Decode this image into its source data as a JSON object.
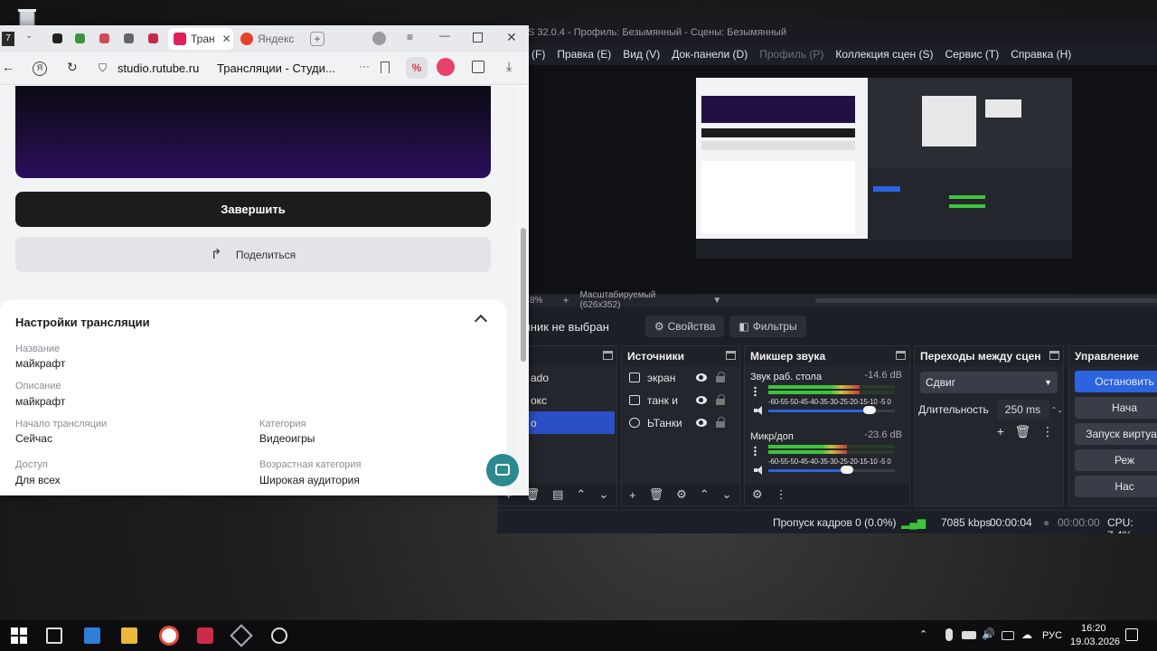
{
  "obs": {
    "title": "S 32.0.4 - Профиль: Безымянный - Сцены: Безымянный",
    "menu": [
      {
        "label": "(F)",
        "dim": false
      },
      {
        "label": "Правка (E)",
        "dim": false
      },
      {
        "label": "Вид (V)",
        "dim": false
      },
      {
        "label": "Док-панели (D)",
        "dim": false
      },
      {
        "label": "Профиль (P)",
        "dim": true
      },
      {
        "label": "Коллекция сцен (S)",
        "dim": false
      },
      {
        "label": "Сервис (T)",
        "dim": false
      },
      {
        "label": "Справка (H)",
        "dim": false
      }
    ],
    "zoom_percent": "8%",
    "zoom_mode": "Масштабируемый (626x352)",
    "no_source": "чник не выбран",
    "properties_btn": "Свойства",
    "filters_btn": "Фильтры",
    "scenes_dock": {
      "title": "ы",
      "items": [
        "ado",
        "окс",
        "о"
      ]
    },
    "sources_dock": {
      "title": "Источники",
      "items": [
        "экран",
        "танк и",
        "ЬТанки"
      ]
    },
    "mixer": {
      "title": "Микшер звука",
      "channels": [
        {
          "name": "Звук раб. стола",
          "db": "-14.6 dB",
          "level": 0.72,
          "volume": 0.8
        },
        {
          "name": "Микр/доп",
          "db": "-23.6 dB",
          "level": 0.62,
          "volume": 0.62
        }
      ],
      "scale": "-60-55-50-45-40-35-30-25-20-15-10 -5  0"
    },
    "transitions": {
      "title": "Переходы между сцен",
      "selected": "Сдвиг",
      "duration_label": "Длительность",
      "duration_value": "250 ms"
    },
    "controls": {
      "title": "Управление",
      "buttons": [
        "Остановить",
        "Нача",
        "Запуск виртуал",
        "Реж",
        "Нас"
      ]
    },
    "status": {
      "dropped": "Пропуск кадров 0 (0.0%)",
      "bitrate": "7085 kbps",
      "stream_time": "00:00:04",
      "record_time": "00:00:00",
      "cpu": "CPU: 7.4%"
    }
  },
  "browser": {
    "tab_count": "7",
    "tabs": [
      {
        "label": "Тран",
        "active": true
      },
      {
        "label": "Яндекс",
        "active": false
      }
    ],
    "url": "studio.rutube.ru",
    "page_title": "Трансляции - Студи...",
    "finish_btn": "Завершить",
    "share_btn": "Поделиться",
    "settings": {
      "title": "Настройки трансляции",
      "fields": {
        "name_label": "Название",
        "name_value": "майкрафт",
        "desc_label": "Описание",
        "desc_value": "майкрафт",
        "start_label": "Начало трансляции",
        "start_value": "Сейчас",
        "category_label": "Категория",
        "category_value": "Видеоигры",
        "access_label": "Доступ",
        "access_value": "Для всех",
        "age_label": "Возрастная категория",
        "age_value": "Широкая аудитория"
      }
    }
  },
  "taskbar": {
    "language": "РУС",
    "time": "16:20",
    "date": "19.03.2026"
  },
  "colors": {
    "obs_bg": "#1d1f26",
    "obs_accent": "#2b63e0",
    "rutube_finish": "#1c1c1e",
    "rutube_video": "#2d0f5e"
  }
}
